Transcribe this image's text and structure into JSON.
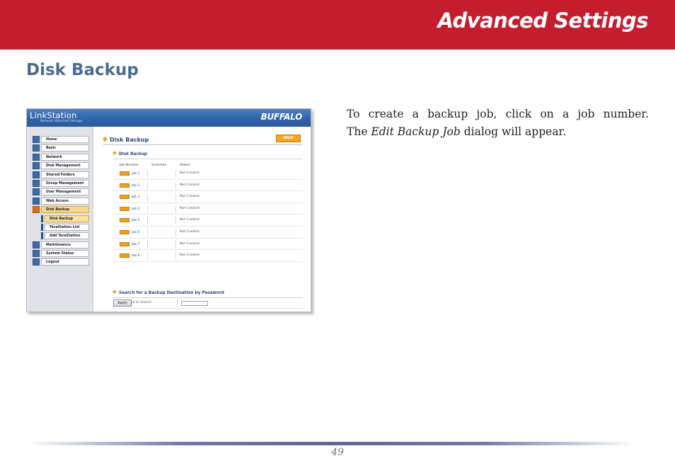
{
  "header": {
    "title": "Advanced Settings"
  },
  "section": {
    "title": "Disk Backup"
  },
  "description": {
    "line1": "To create a backup job, click on a job number.",
    "line2_prefix": "The",
    "line2_em": "Edit Backup Job",
    "line2_suffix": "dialog will appear."
  },
  "screenshot": {
    "logo": "LinkStation",
    "tagline": "Network Attached Storage",
    "brand": "BUFFALO",
    "nav": [
      {
        "label": "Home",
        "icon": "home-icon"
      },
      {
        "label": "Basic",
        "icon": "basic-icon"
      },
      {
        "label": "Network",
        "icon": "network-icon"
      },
      {
        "label": "Disk Management",
        "icon": "disk-icon"
      },
      {
        "label": "Shared Folders",
        "icon": "folder-icon"
      },
      {
        "label": "Group Management",
        "icon": "group-icon"
      },
      {
        "label": "User Management",
        "icon": "user-icon"
      },
      {
        "label": "Web Access",
        "icon": "web-icon"
      },
      {
        "label": "Disk Backup",
        "icon": "backup-icon",
        "active": true
      },
      {
        "label": "Disk Backup",
        "sub": true,
        "active": true
      },
      {
        "label": "TeraStation List",
        "sub": true
      },
      {
        "label": "Add TeraStation",
        "sub": true
      },
      {
        "label": "Maintenance",
        "icon": "maintenance-icon"
      },
      {
        "label": "System Status",
        "icon": "status-icon"
      },
      {
        "label": "Logout",
        "icon": "logout-icon"
      }
    ],
    "main": {
      "title": "Disk Backup",
      "help": "HELP",
      "subtitle": "Disk Backup",
      "columns": [
        "Job Number",
        "Schedule",
        "Status"
      ],
      "jobs": [
        {
          "name": "Job 1",
          "status": "Not Created"
        },
        {
          "name": "Job 2",
          "status": "Not Created"
        },
        {
          "name": "Job 3",
          "status": "Not Created"
        },
        {
          "name": "Job 4",
          "status": "Not Created"
        },
        {
          "name": "Job 5",
          "status": "Not Created"
        },
        {
          "name": "Job 6",
          "status": "Not Created"
        },
        {
          "name": "Job 7",
          "status": "Not Created"
        },
        {
          "name": "Job 8",
          "status": "Not Created"
        }
      ],
      "search_title": "Search for a Backup Destination by Password",
      "password_label": "Password to Search",
      "password_value": "",
      "apply": "Apply"
    }
  },
  "footer": {
    "page": "49"
  }
}
